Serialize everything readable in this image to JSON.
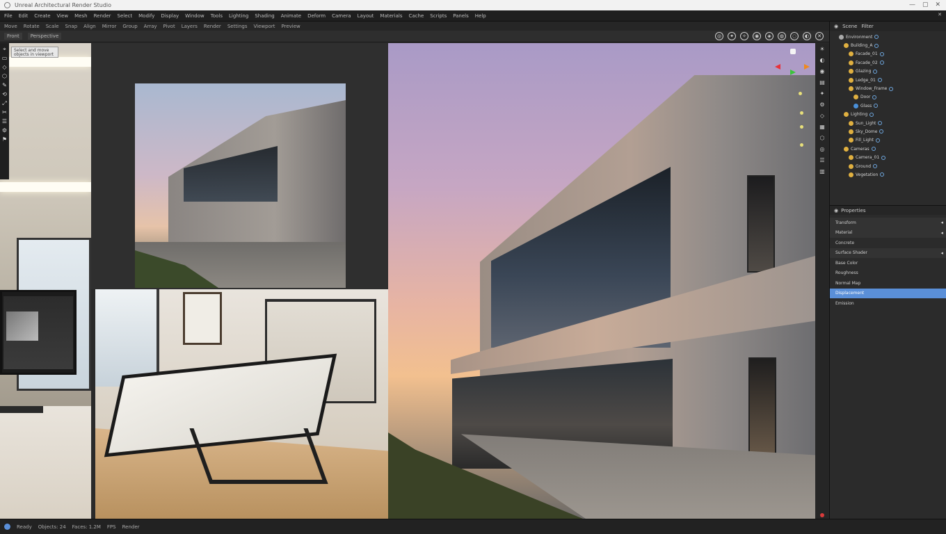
{
  "window": {
    "title": "Unreal Architectural Render Studio",
    "controls": [
      "—",
      "▢",
      "✕"
    ]
  },
  "menubar": {
    "items": [
      "File",
      "Edit",
      "Create",
      "View",
      "Mesh",
      "Render",
      "Select",
      "Modify",
      "Display",
      "Window",
      "Tools",
      "Lighting",
      "Shading",
      "Animate",
      "Deform",
      "Camera",
      "Layout",
      "Materials",
      "Cache",
      "Scripts",
      "Panels",
      "Help"
    ],
    "close": "✕"
  },
  "toolbar": {
    "items": [
      "Move",
      "Rotate",
      "Scale",
      "Snap",
      "Align",
      "Mirror",
      "Group",
      "Array",
      "Pivot",
      "Layers",
      "Render",
      "Settings",
      "Viewport",
      "Preview"
    ]
  },
  "subbar": {
    "tabs": [
      "Front",
      "Perspective"
    ]
  },
  "viewport_icons": [
    "◎",
    "✦",
    "✧",
    "◉",
    "◈",
    "◍",
    "◌",
    "◐",
    "✕"
  ],
  "left_tools": [
    "⌖",
    "▭",
    "◇",
    "⬡",
    "✎",
    "⟲",
    "⤢",
    "✂",
    "☰",
    "⚙",
    "⚑"
  ],
  "tooltip": "Select and move objects in viewport",
  "vstrip_icons": [
    "☀",
    "◐",
    "◉",
    "▤",
    "✦",
    "⚙",
    "◇",
    "▦",
    "⬡",
    "◎",
    "☰",
    "▥"
  ],
  "outliner": {
    "header": [
      "Scene",
      "Filter"
    ],
    "rows": [
      {
        "indent": 1,
        "label": "Environment",
        "icon": "gray"
      },
      {
        "indent": 2,
        "label": "Building_A",
        "icon": "orange"
      },
      {
        "indent": 3,
        "label": "Facade_01",
        "icon": "orange"
      },
      {
        "indent": 3,
        "label": "Facade_02",
        "icon": "orange"
      },
      {
        "indent": 3,
        "label": "Glazing",
        "icon": "orange"
      },
      {
        "indent": 3,
        "label": "Ledge_01",
        "icon": "orange"
      },
      {
        "indent": 3,
        "label": "Window_Frame",
        "icon": "orange"
      },
      {
        "indent": 4,
        "label": "Door",
        "icon": "orange"
      },
      {
        "indent": 4,
        "label": "Glass",
        "icon": "blue"
      },
      {
        "indent": 2,
        "label": "Lighting",
        "icon": "orange"
      },
      {
        "indent": 3,
        "label": "Sun_Light",
        "icon": "orange"
      },
      {
        "indent": 3,
        "label": "Sky_Dome",
        "icon": "orange"
      },
      {
        "indent": 3,
        "label": "Fill_Light",
        "icon": "orange"
      },
      {
        "indent": 2,
        "label": "Cameras",
        "icon": "orange"
      },
      {
        "indent": 3,
        "label": "Camera_01",
        "icon": "orange"
      },
      {
        "indent": 3,
        "label": "Ground",
        "icon": "orange"
      },
      {
        "indent": 3,
        "label": "Vegetation",
        "icon": "orange"
      }
    ]
  },
  "properties": {
    "header": "Properties",
    "rows": [
      {
        "label": "Transform",
        "type": "section"
      },
      {
        "label": "Material",
        "type": "section"
      },
      {
        "label": "Concrete",
        "type": "item"
      },
      {
        "label": "Surface Shader",
        "type": "section"
      },
      {
        "label": "Base Color",
        "type": "item"
      },
      {
        "label": "Roughness",
        "type": "item"
      },
      {
        "label": "Normal Map",
        "type": "item"
      },
      {
        "label": "Displacement",
        "type": "selected"
      },
      {
        "label": "Emission",
        "type": "item"
      }
    ]
  },
  "statusbar": {
    "items": [
      "Ready",
      "Objects: 24",
      "Faces: 1.2M",
      "FPS",
      "Render"
    ]
  }
}
